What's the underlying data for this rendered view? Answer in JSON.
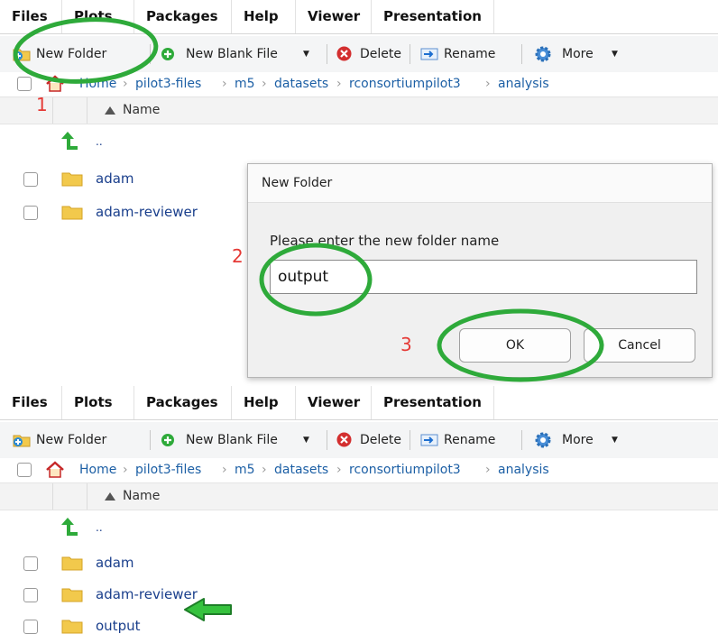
{
  "tabs": [
    "Files",
    "Plots",
    "Packages",
    "Help",
    "Viewer",
    "Presentation"
  ],
  "toolbar": {
    "new_folder": "New Folder",
    "new_blank_file": "New Blank File",
    "delete": "Delete",
    "rename": "Rename",
    "more": "More"
  },
  "breadcrumb": [
    "Home",
    "pilot3-files",
    "m5",
    "datasets",
    "rconsortiumpilot3",
    "analysis"
  ],
  "column_header": "Name",
  "parent_dir": "..",
  "files_before": [
    "adam",
    "adam-reviewer"
  ],
  "files_after": [
    "adam",
    "adam-reviewer",
    "output"
  ],
  "dialog": {
    "title": "New Folder",
    "prompt": "Please enter the new folder name",
    "input_value": "output",
    "ok": "OK",
    "cancel": "Cancel"
  },
  "steps": [
    "1",
    "2",
    "3"
  ],
  "colors": {
    "highlight": "#2eaa3a",
    "step_number": "#e53935",
    "link": "#1a3f8c",
    "folder": "#f2c94c"
  },
  "icons": [
    "new-folder-icon",
    "new-file-icon",
    "delete-icon",
    "rename-icon",
    "gear-icon",
    "home-icon",
    "up-arrow-icon",
    "folder-icon",
    "sort-ascending-icon",
    "annotation-arrow-icon"
  ]
}
